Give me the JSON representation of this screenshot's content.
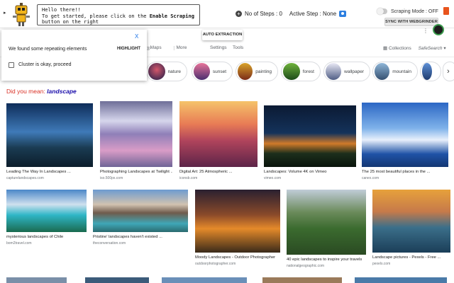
{
  "extension": {
    "speech_line1": "Hello there!!",
    "speech_line2_pre": "To get started, please click on the ",
    "speech_line2_bold": "Enable Scraping",
    "speech_line3": "button on the right",
    "steps_label": "No of Steps : 0",
    "active_step_label": "Active Step : None",
    "scraping_mode_label": "Scraping Mode : OFF",
    "sync_button": "SYNC WITH WEBGRINDER",
    "auto_extraction_button": "AUTO EXTRACTION",
    "accent_color": "#2d7fe0",
    "trash_color": "#e8541d"
  },
  "search_nav": {
    "tabs": [
      "Maps",
      "More",
      "Settings",
      "Tools"
    ],
    "collections": "Collections",
    "safesearch": "SafeSearch"
  },
  "popup": {
    "close": "X",
    "message": "We found some repeating elements",
    "highlight": "HIGHLIGHT",
    "checkbox_label": "Cluster is okay, proceed"
  },
  "chips": [
    "nature",
    "sunset",
    "painting",
    "forest",
    "wallpaper",
    "mountain"
  ],
  "did_you_mean": {
    "prefix": "Did you mean: ",
    "suggestion": "landscape"
  },
  "results_row1": [
    {
      "title": "Leading The Way In Landscapes ...",
      "source": "capturelandscapes.com"
    },
    {
      "title": "Photographing Landscapes at Twilight ...",
      "source": "iso.500px.com"
    },
    {
      "title": "Digital Art: 25 Atmospheric ...",
      "source": "iconsb.com"
    },
    {
      "title": "Landscapes: Volume 4K on Vimeo",
      "source": "vimeo.com"
    },
    {
      "title": "The 25 most beautiful places in the ...",
      "source": "canex.com"
    }
  ],
  "results_row2": [
    {
      "title": "mysterious landscapes of Chile",
      "source": "bom2travel.com"
    },
    {
      "title": "Pristine' landscapes haven't existed ...",
      "source": "theconversation.com"
    },
    {
      "title": "Moody Landscapes - Outdoor Photographer",
      "source": "outdoorphotographer.com"
    },
    {
      "title": "40 epic landscapes to inspire your travels",
      "source": "nationalgeographic.com"
    },
    {
      "title": "Landscape pictures - Pexels - Free ...",
      "source": "pexels.com"
    }
  ]
}
